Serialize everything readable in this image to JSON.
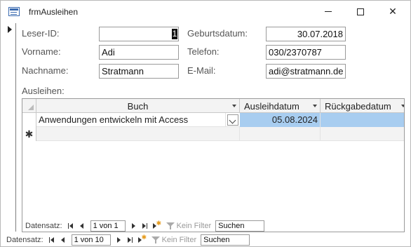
{
  "window": {
    "title": "frmAusleihen",
    "minimize_symbol": "",
    "close_symbol": "✕"
  },
  "form": {
    "leser_id": {
      "label": "Leser-ID:",
      "value": "1"
    },
    "vorname": {
      "label": "Vorname:",
      "value": "Adi"
    },
    "nachname": {
      "label": "Nachname:",
      "value": "Stratmann"
    },
    "geburtsdatum": {
      "label": "Geburtsdatum:",
      "value": "30.07.2018"
    },
    "telefon": {
      "label": "Telefon:",
      "value": "030/2370787"
    },
    "email": {
      "label": "E-Mail:",
      "value": "adi@stratmann.de"
    }
  },
  "subform": {
    "label": "Ausleihen:",
    "columns": [
      "Buch",
      "Ausleihdatum",
      "Rückgabedatum"
    ],
    "rows": [
      {
        "buch": "Anwendungen entwickeln mit Access",
        "ausleihdatum": "05.08.2024",
        "rueckgabedatum": ""
      }
    ],
    "new_row_marker": "✱",
    "nav": {
      "label": "Datensatz:",
      "record": "1 von 1",
      "filter": "Kein Filter",
      "search": "Suchen"
    }
  },
  "main_nav": {
    "label": "Datensatz:",
    "record": "1 von 10",
    "filter": "Kein Filter",
    "search": "Suchen"
  }
}
